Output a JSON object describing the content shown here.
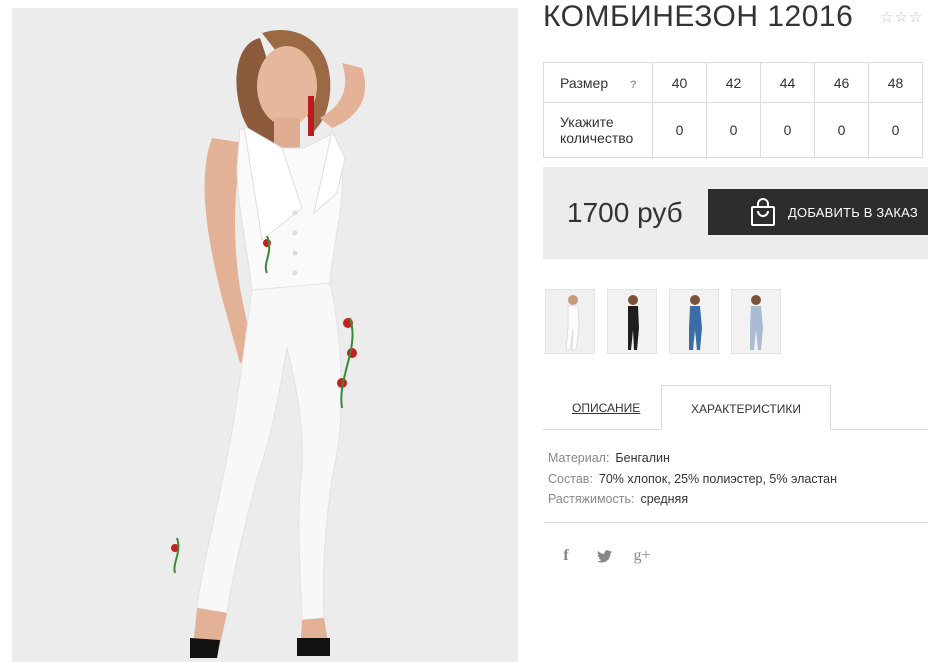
{
  "product": {
    "title": "КОМБИНЕЗОН 12016",
    "rating_stars": "☆☆☆"
  },
  "size_table": {
    "size_label": "Размер",
    "help_label": "?",
    "sizes": [
      "40",
      "42",
      "44",
      "46",
      "48"
    ],
    "qty_label_line1": "Укажите",
    "qty_label_line2": "количество",
    "quantities": [
      "0",
      "0",
      "0",
      "0",
      "0"
    ]
  },
  "price": {
    "value": "1700 руб",
    "add_button_label": "ДОБАВИТЬ В ЗАКАЗ"
  },
  "thumbnails": [
    {
      "color": "white",
      "outfit": "#f5f5f5"
    },
    {
      "color": "black",
      "outfit": "#1e1e1e"
    },
    {
      "color": "blue",
      "outfit": "#3b6ea8"
    },
    {
      "color": "light-blue",
      "outfit": "#a9bcd2"
    }
  ],
  "tabs": {
    "description": "ОПИСАНИЕ",
    "characteristics": "ХАРАКТЕРИСТИКИ"
  },
  "specs": [
    {
      "key": "Материал:",
      "value": "Бенгалин"
    },
    {
      "key": "Состав:",
      "value": "70% хлопок, 25% полиэстер, 5% эластан"
    },
    {
      "key": "Растяжимость:",
      "value": "средняя"
    }
  ],
  "social": {
    "facebook": "f",
    "twitter": "twitter-icon",
    "gplus": "g+"
  },
  "colors": {
    "button_bg": "#2d2d2d",
    "price_box_bg": "#ececec",
    "border": "#dcdcdc"
  }
}
